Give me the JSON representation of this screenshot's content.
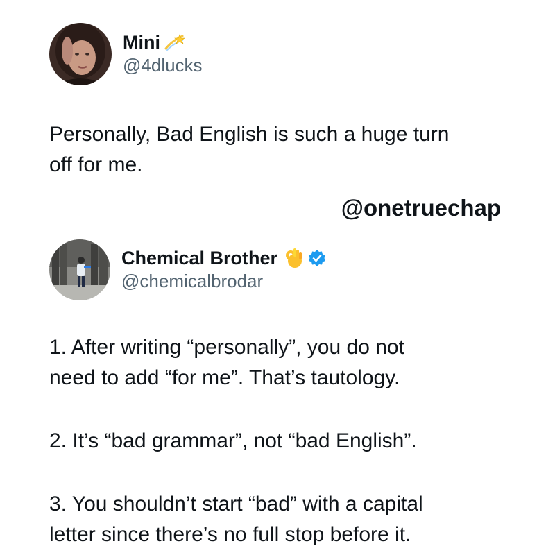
{
  "original_post": {
    "author": {
      "display_name": "Mini",
      "handle": "@4dlucks",
      "name_emoji": "shooting-star-emoji"
    },
    "text_line1": "Personally, Bad English is such a huge turn",
    "text_line2": "off for me."
  },
  "watermark": "@onetruechap",
  "reply_post": {
    "author": {
      "display_name": "Chemical Brother",
      "handle": "@chemicalbrodar",
      "name_emoji": "ok-hand-emoji",
      "verified_icon": "verified-badge-icon",
      "verified_color": "#1d9bf0"
    },
    "points": [
      {
        "line1": "1. After writing “personally”, you do not",
        "line2": "need to add “for me”. That’s tautology."
      },
      {
        "line1": "2. It’s “bad grammar”, not “bad English”.",
        "line2": ""
      },
      {
        "line1": "3. You shouldn’t start “bad” with a capital",
        "line2": "letter since there’s no full stop before it."
      }
    ]
  }
}
